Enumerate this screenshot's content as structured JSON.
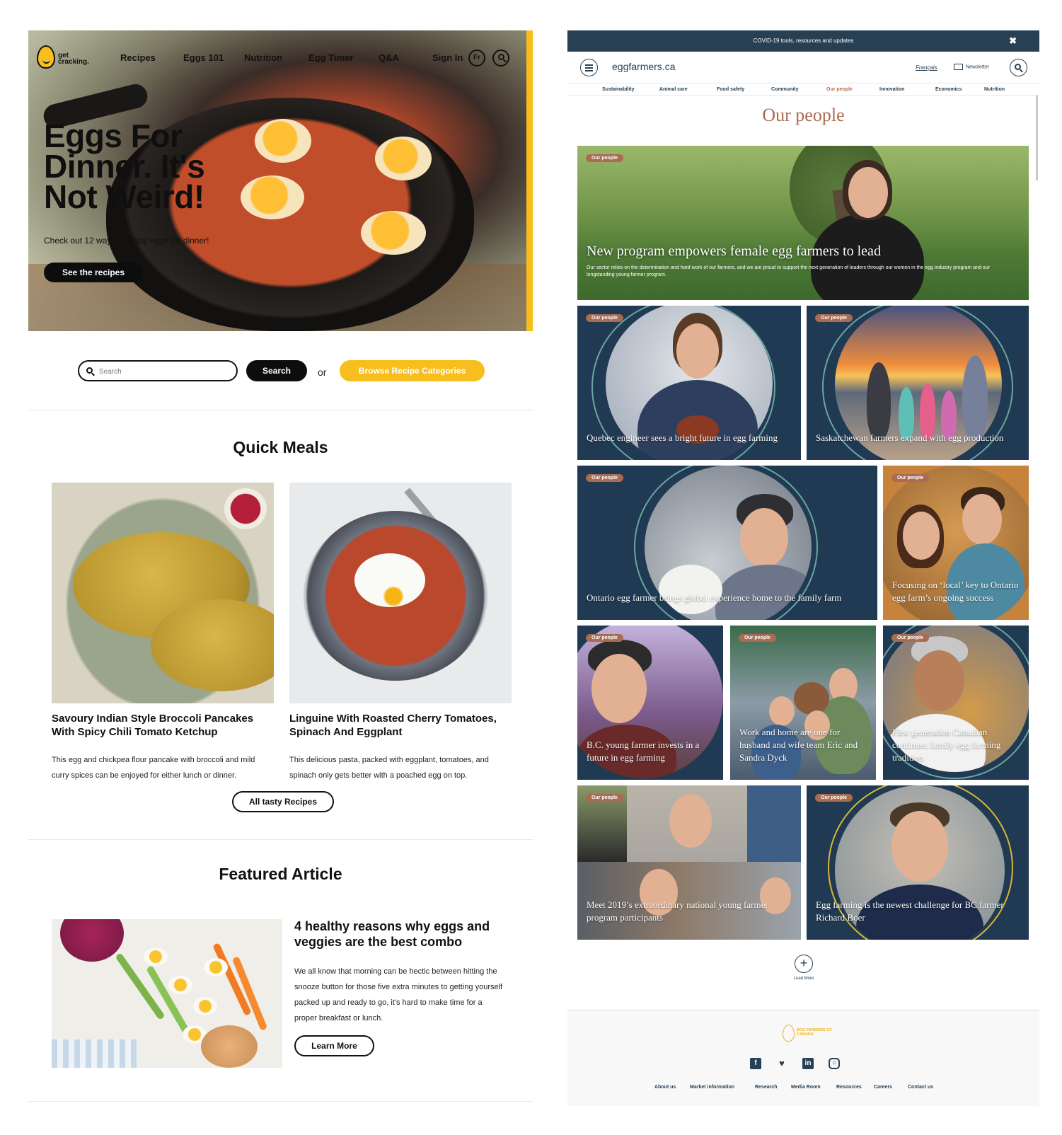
{
  "left": {
    "logo_text": "get cracking.",
    "nav": [
      "Recipes",
      "Eggs 101",
      "Nutrition",
      "Egg Timer",
      "Q&A"
    ],
    "sign_in": "Sign In",
    "lang_badge": "Fr",
    "hero": {
      "title": "Eggs For Dinner. It's Not Weird!",
      "subtitle": "Check out 12 ways to enjoy eggs for dinner!",
      "button": "See the recipes"
    },
    "search": {
      "placeholder": "Search",
      "button": "Search",
      "or": "or",
      "browse": "Browse Recipe Categories"
    },
    "quick_meals": {
      "heading": "Quick Meals",
      "recipes": [
        {
          "title": "Savoury Indian Style Broccoli Pancakes With Spicy Chili Tomato Ketchup",
          "desc": "This egg and chickpea flour pancake with broccoli and mild curry spices can be enjoyed for either lunch or dinner."
        },
        {
          "title": "Linguine With Roasted Cherry Tomatoes, Spinach And Eggplant",
          "desc": "This delicious pasta, packed with eggplant, tomatoes, and spinach only gets better with a poached egg on top."
        }
      ],
      "all_button": "All tasty Recipes"
    },
    "featured": {
      "heading": "Featured Article",
      "title": "4 healthy reasons why eggs and veggies are the best combo",
      "desc": "We all know that morning can be hectic between hitting the snooze button for those five extra minutes to getting yourself packed up and ready to go, it's hard to make time for a proper breakfast or lunch.",
      "button": "Learn More"
    }
  },
  "right": {
    "covid_banner": "COVID-19 tools, resources and updates",
    "close_glyph": "✖",
    "site_name": "eggfarmers.ca",
    "lang_link": "Français",
    "newsletter": "Newsletter",
    "subnav": [
      "Sustainability",
      "Animal care",
      "Food safety",
      "Community",
      "Our people",
      "Innovation",
      "Economics",
      "Nutrition"
    ],
    "subnav_active": "Our people",
    "page_title": "Our people",
    "tag": "Our people",
    "feature": {
      "title": "New program empowers female egg farmers to lead",
      "desc": "Our sector relies on the determination and hard work of our farmers, and we are proud to support the next generation of leaders through our women in the egg industry program and our longstanding young farmer program."
    },
    "cards": [
      "Quebec engineer sees a bright future in egg farming",
      "Saskatchewan farmers expand with egg production",
      "Ontario egg farmer brings global experience home to the family farm",
      "Focusing on ‘local’ key to Ontario egg farm’s ongoing success",
      "B.C. young farmer invests in a future in egg farming",
      "Work and home are one for husband and wife team Eric and Sandra Dyck",
      "First generation Canadian continues family egg farming tradition",
      "Meet 2019’s extraordinary national young farmer program participants",
      "Egg farming is the newest challenge for BC farmer Richard Boer"
    ],
    "load_more": "Load More",
    "footer_logo": "EGG FARMERS OF CANADA",
    "social": [
      "facebook-icon",
      "twitter-icon",
      "linkedin-icon",
      "instagram-icon"
    ],
    "footer_links": [
      "About us",
      "Market information",
      "Research",
      "Media Room",
      "Resources",
      "Careers",
      "Contact us"
    ]
  },
  "colors": {
    "brand_yellow": "#f7be1d",
    "ef_navy": "#274054",
    "ef_card": "#1f3a52",
    "ef_accent": "#a96b51",
    "ring_teal": "#6aa6a0"
  }
}
